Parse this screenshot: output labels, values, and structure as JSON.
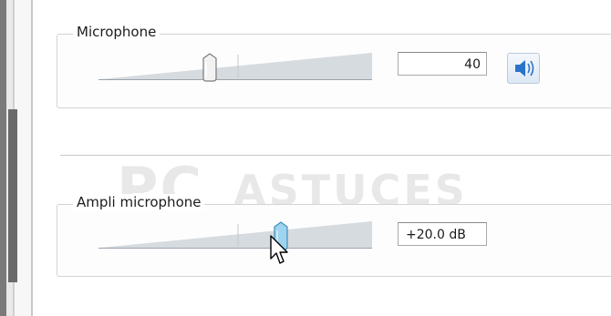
{
  "microphone": {
    "label": "Microphone",
    "level_percent": 40,
    "value_text": "40",
    "mute_icon": "speaker-icon"
  },
  "ampli_microphone": {
    "label": "Ampli microphone",
    "level_fraction": 0.67,
    "value_text": "+20.0 dB"
  },
  "colors": {
    "group_border": "#d3d3d3",
    "thumb_active": "#7fc3e6",
    "speaker_blue": "#2a73c9"
  }
}
